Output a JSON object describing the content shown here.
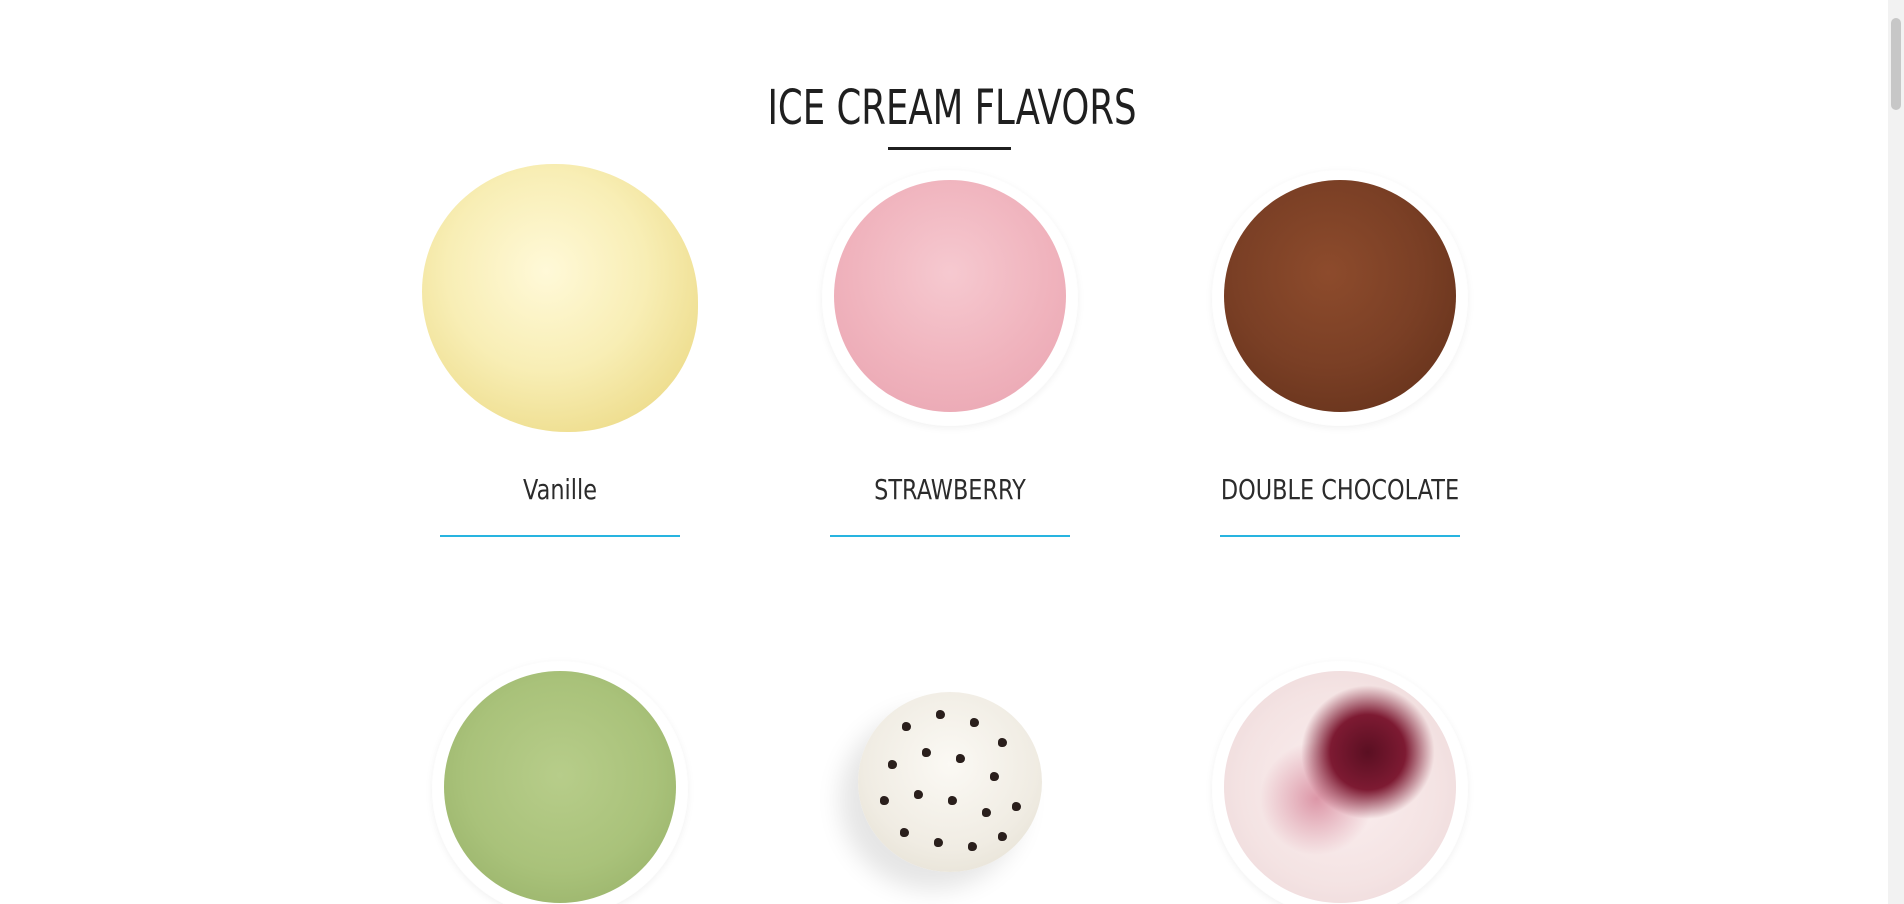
{
  "page": {
    "title": "ICE CREAM FLAVORS"
  },
  "flavors": [
    {
      "name": "Vanille",
      "image": "vanilla-scoop",
      "color": "#f7ecb0"
    },
    {
      "name": "STRAWBERRY",
      "image": "strawberry-cup",
      "color": "#efb6c0"
    },
    {
      "name": "DOUBLE CHOCOLATE",
      "image": "chocolate-cup",
      "color": "#7a3f25"
    },
    {
      "name": "",
      "image": "pistachio-cup",
      "color": "#a9c27a"
    },
    {
      "name": "",
      "image": "chocolate-chip-scoop",
      "color": "#f0ece3"
    },
    {
      "name": "",
      "image": "berry-swirl-cup",
      "color": "#f4e3e3"
    }
  ],
  "colors": {
    "accent": "#28b4e0",
    "text": "#1f1f1f"
  }
}
